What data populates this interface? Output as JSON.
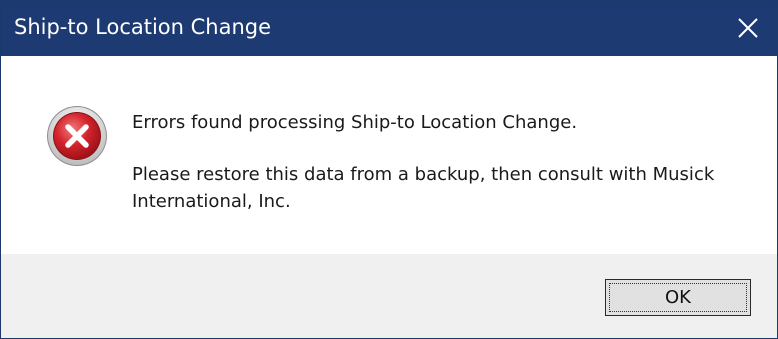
{
  "window": {
    "title": "Ship-to Location Change",
    "titlebar_color": "#1d3a72"
  },
  "message": {
    "icon": "error-icon",
    "line1": "Errors found processing Ship-to Location Change.",
    "line2": "Please restore this data from a backup, then consult with Musick International, Inc."
  },
  "buttons": {
    "ok_label": "OK",
    "close_icon": "close-icon"
  },
  "colors": {
    "error_red": "#c8202a",
    "footer_bg": "#f0f0f0"
  }
}
